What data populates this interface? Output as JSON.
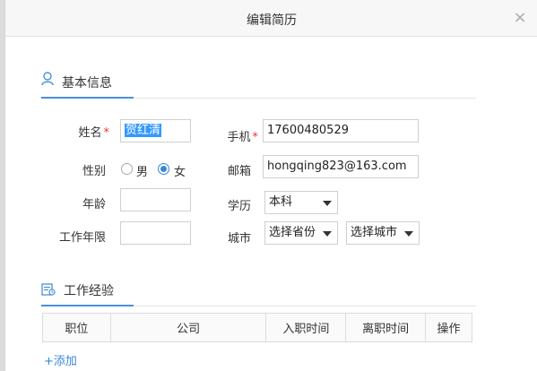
{
  "dialog": {
    "title": "编辑简历",
    "close_glyph": "×"
  },
  "basic_info": {
    "section_title": "基本信息",
    "name_label": "姓名",
    "required_mark": "*",
    "name_value": "贺红清",
    "gender_label": "性别",
    "gender_options": [
      "男",
      "女"
    ],
    "gender_selected": "女",
    "age_label": "年龄",
    "age_value": "",
    "work_years_label": "工作年限",
    "work_years_value": "",
    "phone_label": "手机",
    "phone_value": "17600480529",
    "email_label": "邮箱",
    "email_value": "hongqing823@163.com",
    "education_label": "学历",
    "education_value": "本科",
    "city_label": "城市",
    "province_placeholder": "选择省份",
    "city_placeholder": "选择城市"
  },
  "work_experience": {
    "section_title": "工作经验",
    "columns": [
      "职位",
      "公司",
      "入职时间",
      "离职时间",
      "操作"
    ],
    "add_label": "+添加"
  },
  "colors": {
    "accent": "#3b88d8",
    "required": "#e33333",
    "selection": "#3399ff"
  }
}
